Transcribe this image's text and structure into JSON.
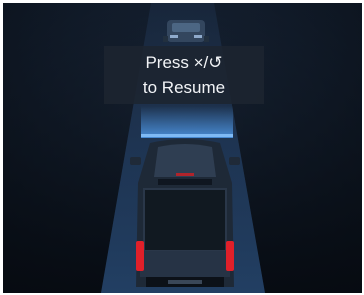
{
  "message": {
    "line1": "Press ×/↺",
    "line2": "to Resume"
  },
  "colors": {
    "background": "#131e2e",
    "lane": "#1f3a5a",
    "follow_indicator": "#6aa8ea",
    "tail_light": "#e0202a"
  },
  "icons": {
    "lead_vehicle": "car-icon",
    "ego_vehicle": "pickup-truck-icon"
  }
}
